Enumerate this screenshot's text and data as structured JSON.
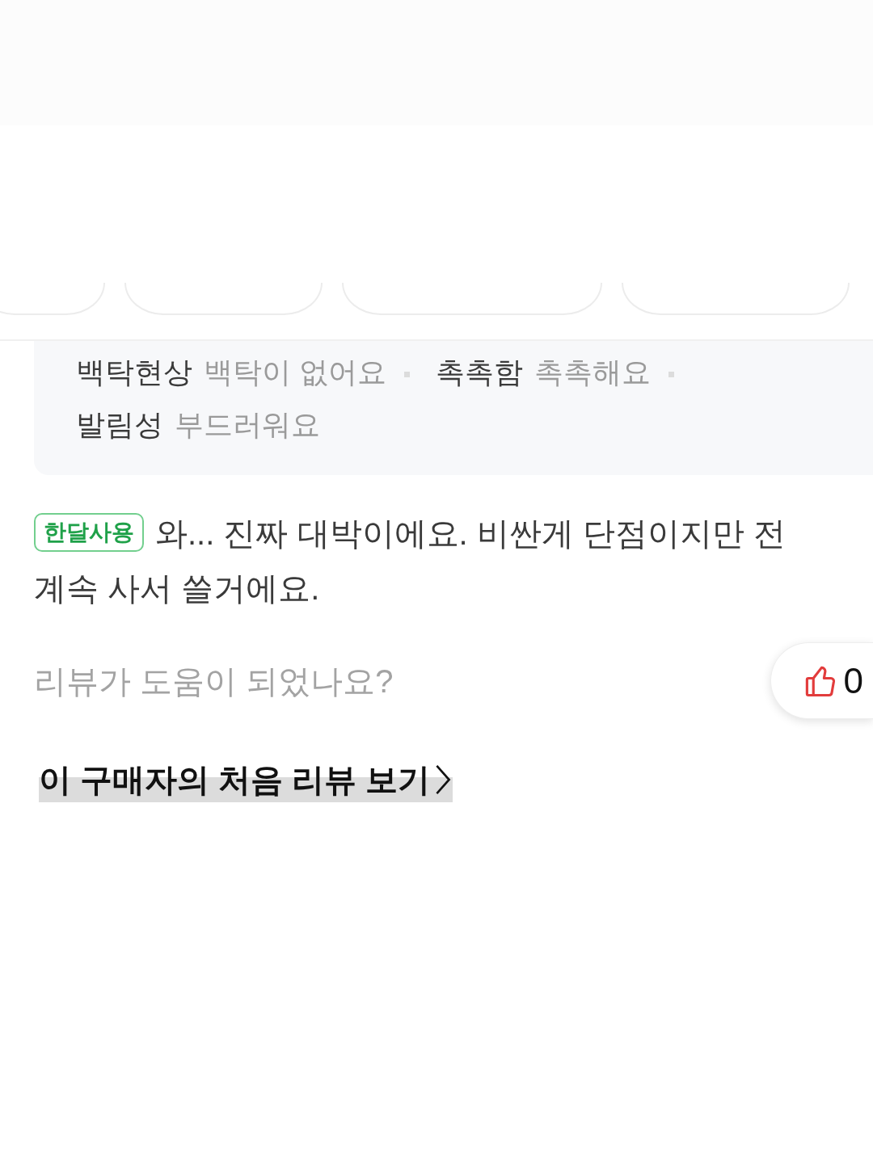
{
  "attributes": [
    {
      "label": "백탁현상",
      "value": "백탁이 없어요"
    },
    {
      "label": "촉촉함",
      "value": "촉촉해요"
    },
    {
      "label": "발림성",
      "value": "부드러워요"
    }
  ],
  "review": {
    "badge": "한달사용",
    "text": "와... 진짜 대박이에요. 비싼게 단점이지만 전 계속 사서 쓸거에요."
  },
  "helpful": {
    "question": "리뷰가 도움이 되었나요?",
    "count": "0"
  },
  "first_review_link": "이 구매자의 처음 리뷰 보기"
}
